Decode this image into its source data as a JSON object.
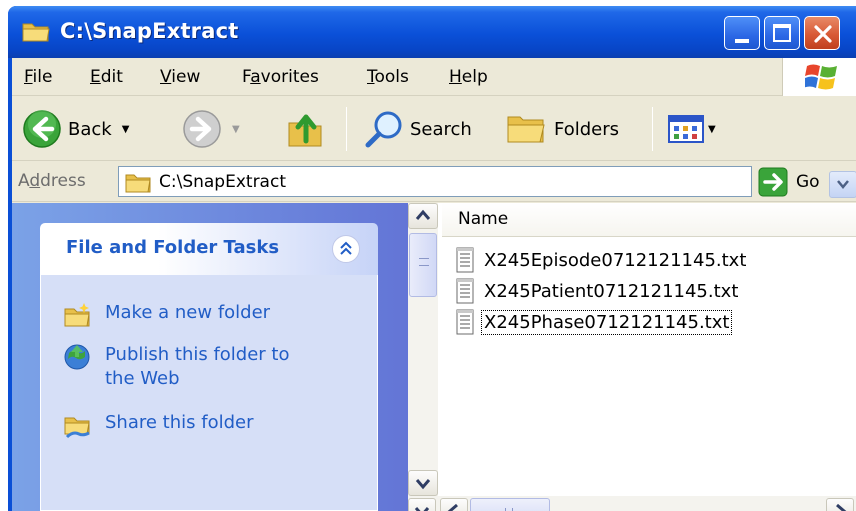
{
  "window": {
    "title": "C:\\SnapExtract",
    "controls": {
      "minimize": "minimize-icon",
      "maximize": "maximize-icon",
      "close": "close-icon"
    }
  },
  "menu": [
    {
      "label": "File",
      "underline": "F",
      "rest": "ile"
    },
    {
      "label": "Edit",
      "underline": "E",
      "rest": "dit"
    },
    {
      "label": "View",
      "underline": "V",
      "rest": "iew"
    },
    {
      "label": "Favorites",
      "pre": "F",
      "underline": "a",
      "rest": "vorites"
    },
    {
      "label": "Tools",
      "underline": "T",
      "rest": "ools"
    },
    {
      "label": "Help",
      "underline": "H",
      "rest": "elp"
    }
  ],
  "toolbar": {
    "back_label": "Back",
    "search_label": "Search",
    "folders_label": "Folders"
  },
  "address": {
    "label_pre": "A",
    "label_u": "d",
    "label_rest": "dress",
    "value": "C:\\SnapExtract",
    "go_label": "Go"
  },
  "tasks": {
    "title": "File and Folder Tasks",
    "items": [
      {
        "label": "Make a new folder",
        "icon": "new-folder-icon"
      },
      {
        "label": "Publish this folder to the Web",
        "icon": "publish-web-icon"
      },
      {
        "label": "Share this folder",
        "icon": "share-folder-icon"
      }
    ]
  },
  "files": {
    "column": "Name",
    "items": [
      {
        "name": "X245Episode0712121145.txt",
        "selected": false
      },
      {
        "name": "X245Patient0712121145.txt",
        "selected": false
      },
      {
        "name": "X245Phase0712121145.txt",
        "selected": true
      }
    ]
  },
  "colors": {
    "title_blue": "#0a50d8",
    "task_link": "#215dc6",
    "chrome": "#ece9d8"
  }
}
